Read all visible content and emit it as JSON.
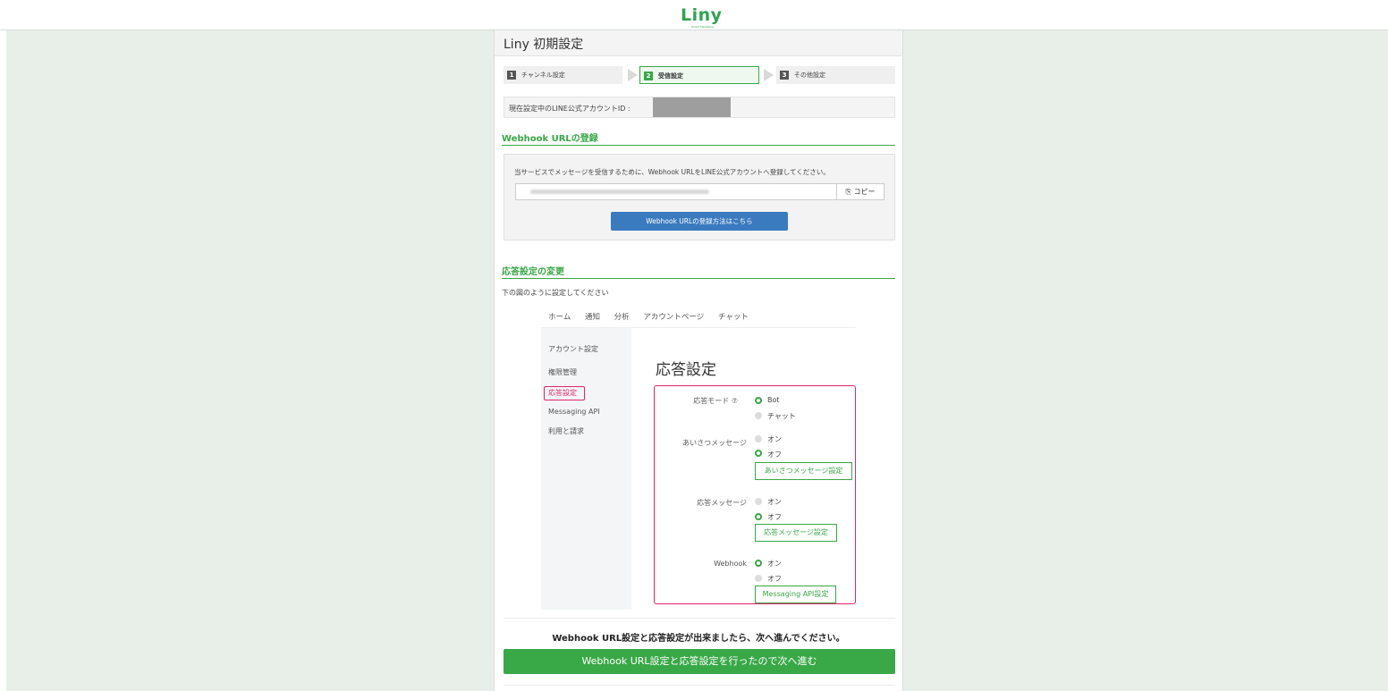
{
  "header": {
    "logo": "Liny",
    "logo_sub": "Smart Marketing"
  },
  "page": {
    "title": "Liny 初期設定"
  },
  "steps": [
    {
      "num": "1",
      "label": "チャンネル設定"
    },
    {
      "num": "2",
      "label": "受信設定"
    },
    {
      "num": "3",
      "label": "その他設定"
    }
  ],
  "account": {
    "label": "現在設定中のLINE公式アカウントID :"
  },
  "webhook_section": {
    "title": "Webhook URLの登録",
    "description": "当サービスでメッセージを受信するために、Webhook URLをLINE公式アカウントへ登録してください。",
    "copy_label": "コピー",
    "howto_label": "Webhook URLの登録方法はこちら"
  },
  "response_section": {
    "title": "応答設定の変更",
    "instruction": "下の図のように設定してください"
  },
  "illustration": {
    "tabs": [
      "ホーム",
      "通知",
      "分析",
      "アカウントページ",
      "チャット"
    ],
    "side_items": [
      "アカウント設定",
      "権限管理",
      "応答設定",
      "Messaging API",
      "利用と請求"
    ],
    "title": "応答設定",
    "rows": {
      "mode_label": "応答モード ⑦",
      "mode_bot": "Bot",
      "mode_chat": "チャット",
      "greeting_label": "あいさつメッセージ",
      "greeting_on": "オン",
      "greeting_off": "オフ",
      "greeting_btn": "あいさつメッセージ設定",
      "auto_label": "応答メッセージ",
      "auto_on": "オン",
      "auto_off": "オフ",
      "auto_btn": "応答メッセージ設定",
      "webhook_label": "Webhook",
      "webhook_on": "オン",
      "webhook_off": "オフ",
      "webhook_btn": "Messaging API設定"
    }
  },
  "footer": {
    "done_text": "Webhook URL設定と応答設定が出来ましたら、次へ進んでください。",
    "next_label": "Webhook URL設定と応答設定を行ったので次へ進む"
  },
  "colors": {
    "accent": "#39a847",
    "highlight": "#e0256e",
    "link_button": "#3a7abf"
  }
}
